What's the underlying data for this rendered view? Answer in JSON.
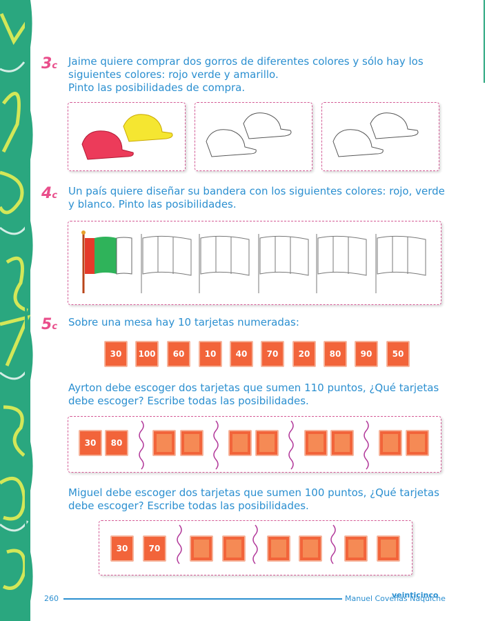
{
  "questions": [
    {
      "number": "3",
      "suffix": "c",
      "lines": [
        "Jaime quiere comprar dos gorros de diferentes colores y sólo hay los",
        "siguientes colores:  rojo verde y amarillo.",
        "Pinto las posibilidades de compra."
      ]
    },
    {
      "number": "4",
      "suffix": "c",
      "lines": [
        "Un país quiere diseñar su bandera con los siguientes colores: rojo, verde",
        "y blanco. Pinto las posibilidades."
      ]
    },
    {
      "number": "5",
      "suffix": "c",
      "lines": [
        "Sobre una mesa hay 10 tarjetas numeradas:"
      ]
    }
  ],
  "cards": [
    "30",
    "100",
    "60",
    "10",
    "40",
    "70",
    "20",
    "80",
    "90",
    "50"
  ],
  "ayrton": {
    "lines": [
      "Ayrton debe escoger dos tarjetas que sumen 110 puntos, ¿Qué tarjetas",
      "debe escoger? Escribe todas las posibilidades."
    ],
    "example": [
      "30",
      "80"
    ]
  },
  "miguel": {
    "lines": [
      "Miguel debe escoger dos tarjetas que sumen 100 puntos, ¿Qué tarjetas",
      "debe escoger? Escribe todas las posibilidades."
    ],
    "example": [
      "30",
      "70"
    ]
  },
  "footer": {
    "page": "260",
    "author": "Manuel Coveñas Naquiche",
    "page_word": "veinticinco"
  },
  "colors": {
    "accent_blue": "#2b8fd0",
    "pink": "#e94e8b",
    "card": "#f2643a",
    "side_green": "#2aa77f"
  }
}
